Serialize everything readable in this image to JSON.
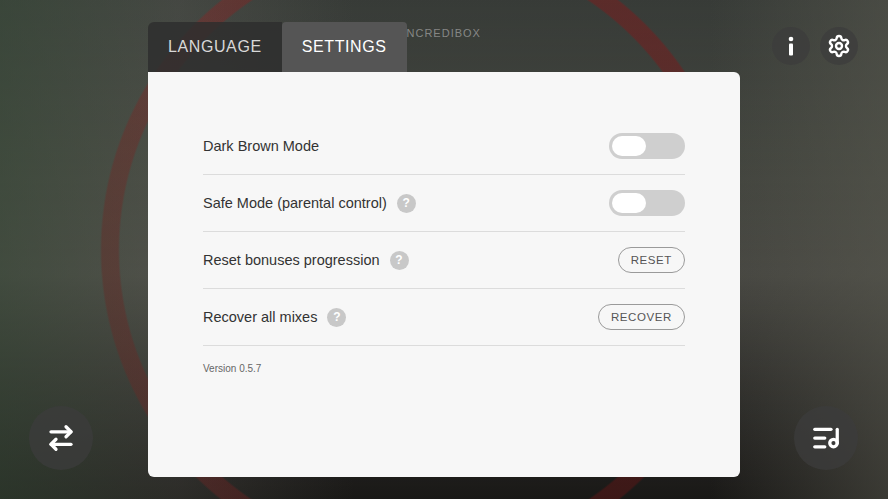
{
  "header": {
    "title": "NCREDIBOX"
  },
  "tabs": [
    {
      "label": "LANGUAGE",
      "selected": false
    },
    {
      "label": "SETTINGS",
      "selected": true
    }
  ],
  "settings": [
    {
      "label": "Dark Brown Mode",
      "kind": "toggle",
      "on": false
    },
    {
      "label": "Safe Mode (parental control)",
      "kind": "toggle",
      "on": false,
      "help": "?"
    },
    {
      "label": "Reset bonuses progression",
      "kind": "button",
      "button": "RESET",
      "help": "?"
    },
    {
      "label": "Recover all mixes",
      "kind": "button",
      "button": "RECOVER",
      "help": "?"
    }
  ],
  "version": "Version 0.5.7"
}
